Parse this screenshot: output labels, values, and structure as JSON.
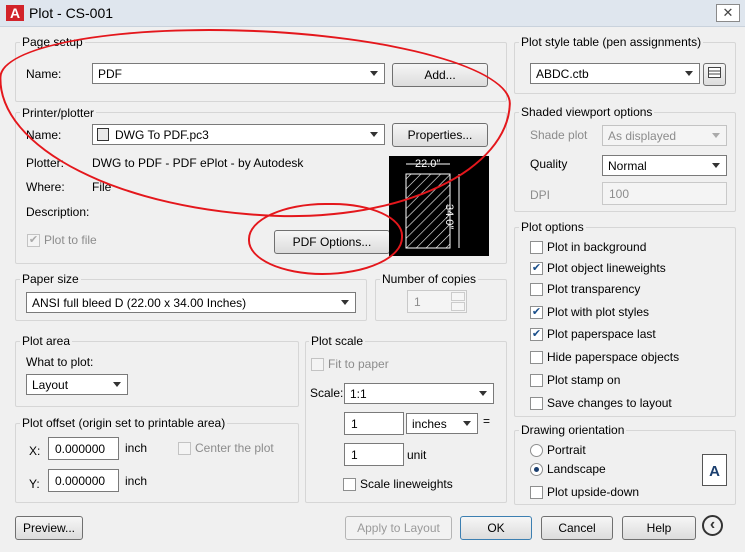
{
  "window": {
    "title": "Plot - CS-001",
    "app_icon_letter": "A",
    "close_glyph": "✕"
  },
  "page_setup": {
    "group_label": "Page setup",
    "name_label": "Name:",
    "name_value": "PDF",
    "add_button": "Add..."
  },
  "printer": {
    "group_label": "Printer/plotter",
    "name_label": "Name:",
    "name_value": "DWG To PDF.pc3",
    "properties_button": "Properties...",
    "plotter_label": "Plotter:",
    "plotter_value": "DWG to PDF - PDF ePlot - by Autodesk",
    "where_label": "Where:",
    "where_value": "File",
    "description_label": "Description:",
    "plot_to_file_label": "Plot to file",
    "plot_to_file_checked": true,
    "pdf_options_button": "PDF Options...",
    "preview_width": "22.0″",
    "preview_height": "34.0″"
  },
  "paper_size": {
    "group_label": "Paper size",
    "value": "ANSI full bleed D (22.00 x 34.00 Inches)"
  },
  "copies": {
    "group_label": "Number of copies",
    "value": "1"
  },
  "plot_area": {
    "group_label": "Plot area",
    "what_label": "What to plot:",
    "what_value": "Layout"
  },
  "plot_offset": {
    "group_label": "Plot offset (origin set to printable area)",
    "x_label": "X:",
    "x_value": "0.000000",
    "x_unit": "inch",
    "y_label": "Y:",
    "y_value": "0.000000",
    "y_unit": "inch",
    "center_label": "Center the plot"
  },
  "plot_scale": {
    "group_label": "Plot scale",
    "fit_label": "Fit to paper",
    "scale_label": "Scale:",
    "scale_value": "1:1",
    "value1": "1",
    "units": "inches",
    "equals": "=",
    "value2": "1",
    "unit2": "unit",
    "lineweights_label": "Scale lineweights"
  },
  "plot_style": {
    "group_label": "Plot style table (pen assignments)",
    "value": "ABDC.ctb"
  },
  "shaded": {
    "group_label": "Shaded viewport options",
    "shade_label": "Shade plot",
    "shade_value": "As displayed",
    "quality_label": "Quality",
    "quality_value": "Normal",
    "dpi_label": "DPI",
    "dpi_value": "100"
  },
  "plot_options": {
    "group_label": "Plot options",
    "items": [
      {
        "label": "Plot in background",
        "checked": false
      },
      {
        "label": "Plot object lineweights",
        "checked": true
      },
      {
        "label": "Plot transparency",
        "checked": false
      },
      {
        "label": "Plot with plot styles",
        "checked": true
      },
      {
        "label": "Plot paperspace last",
        "checked": true
      },
      {
        "label": "Hide paperspace objects",
        "checked": false
      },
      {
        "label": "Plot stamp on",
        "checked": false
      },
      {
        "label": "Save changes to layout",
        "checked": false
      }
    ]
  },
  "orientation": {
    "group_label": "Drawing orientation",
    "portrait_label": "Portrait",
    "landscape_label": "Landscape",
    "selected": "Landscape",
    "upside_label": "Plot upside-down",
    "icon_letter": "A"
  },
  "footer": {
    "preview": "Preview...",
    "apply": "Apply to Layout",
    "ok": "OK",
    "cancel": "Cancel",
    "help": "Help",
    "expand_glyph": "‹"
  },
  "colors": {
    "annotation": "#e4171c",
    "preview_bg": "#000000"
  }
}
